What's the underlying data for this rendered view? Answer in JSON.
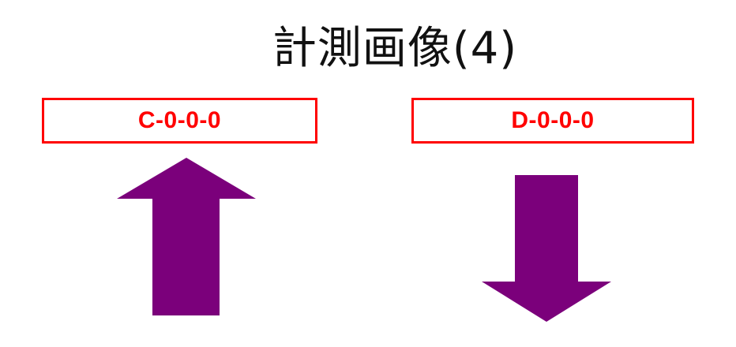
{
  "title": "計測画像(4)",
  "labels": {
    "left": "C-0-0-0",
    "right": "D-0-0-0"
  },
  "arrows": {
    "left": "up",
    "right": "down"
  },
  "colors": {
    "label_border": "#ff0000",
    "label_text": "#ff0000",
    "arrow_fill": "#7b007b",
    "title_text": "#111111"
  }
}
